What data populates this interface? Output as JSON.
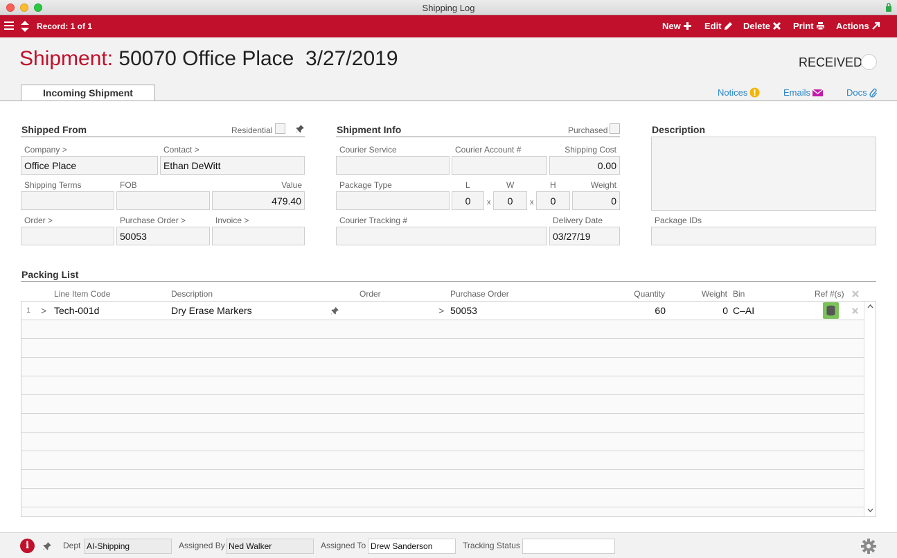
{
  "window": {
    "title": "Shipping Log"
  },
  "toolbar": {
    "record": "Record: 1 of 1",
    "new_label": "New",
    "edit_label": "Edit",
    "delete_label": "Delete",
    "print_label": "Print",
    "actions_label": "Actions"
  },
  "header": {
    "label": "Shipment:",
    "title": "50070 Office Place  3/27/2019",
    "status": "RECEIVED",
    "tab": "Incoming Shipment",
    "links": {
      "notices": "Notices",
      "emails": "Emails",
      "docs": "Docs"
    }
  },
  "shipped_from": {
    "title": "Shipped From",
    "residential_label": "Residential",
    "residential_checked": false,
    "company_label": "Company >",
    "company": "Office Place",
    "contact_label": "Contact >",
    "contact": "Ethan DeWitt",
    "shipping_terms_label": "Shipping Terms",
    "shipping_terms": "",
    "fob_label": "FOB",
    "fob": "",
    "value_label": "Value",
    "value": "479.40",
    "order_label": "Order >",
    "order": "",
    "purchase_order_label": "Purchase Order >",
    "purchase_order": "50053",
    "invoice_label": "Invoice >",
    "invoice": ""
  },
  "shipment_info": {
    "title": "Shipment Info",
    "purchased_label": "Purchased",
    "purchased_checked": false,
    "courier_service_label": "Courier Service",
    "courier_service": "",
    "courier_account_label": "Courier Account #",
    "courier_account": "",
    "shipping_cost_label": "Shipping Cost",
    "shipping_cost": "0.00",
    "package_type_label": "Package Type",
    "package_type": "",
    "l_label": "L",
    "l": "0",
    "w_label": "W",
    "w": "0",
    "h_label": "H",
    "h": "0",
    "x_sep": "x",
    "weight_label": "Weight",
    "weight": "0",
    "tracking_label": "Courier Tracking #",
    "tracking": "",
    "delivery_date_label": "Delivery Date",
    "delivery_date": "03/27/19"
  },
  "description": {
    "title": "Description",
    "text": "",
    "package_ids_label": "Package IDs",
    "package_ids": ""
  },
  "packing_list": {
    "title": "Packing List",
    "columns": {
      "line_item_code": "Line Item Code",
      "description": "Description",
      "order": "Order",
      "purchase_order": "Purchase Order",
      "quantity": "Quantity",
      "weight": "Weight",
      "bin": "Bin",
      "refs": "Ref #(s)"
    },
    "rows": [
      {
        "num": "1",
        "arrow": ">",
        "code": "Tech-001d",
        "description": "Dry Erase Markers",
        "order": "",
        "po_arrow": ">",
        "purchase_order": "50053",
        "quantity": "60",
        "weight": "0",
        "bin": "C–AI"
      }
    ]
  },
  "bottom": {
    "info_glyph": "i",
    "dept_label": "Dept",
    "dept": "AI-Shipping",
    "assigned_by_label": "Assigned By",
    "assigned_by": "Ned Walker",
    "assigned_to_label": "Assigned To",
    "assigned_to": "Drew Sanderson",
    "tracking_status_label": "Tracking Status",
    "tracking_status": ""
  },
  "colors": {
    "brand_red": "#c0102b",
    "link_blue": "#2a86c8",
    "notice_yellow": "#f5b400",
    "email_magenta": "#c21aa8",
    "ref_green": "#7cc25b"
  }
}
